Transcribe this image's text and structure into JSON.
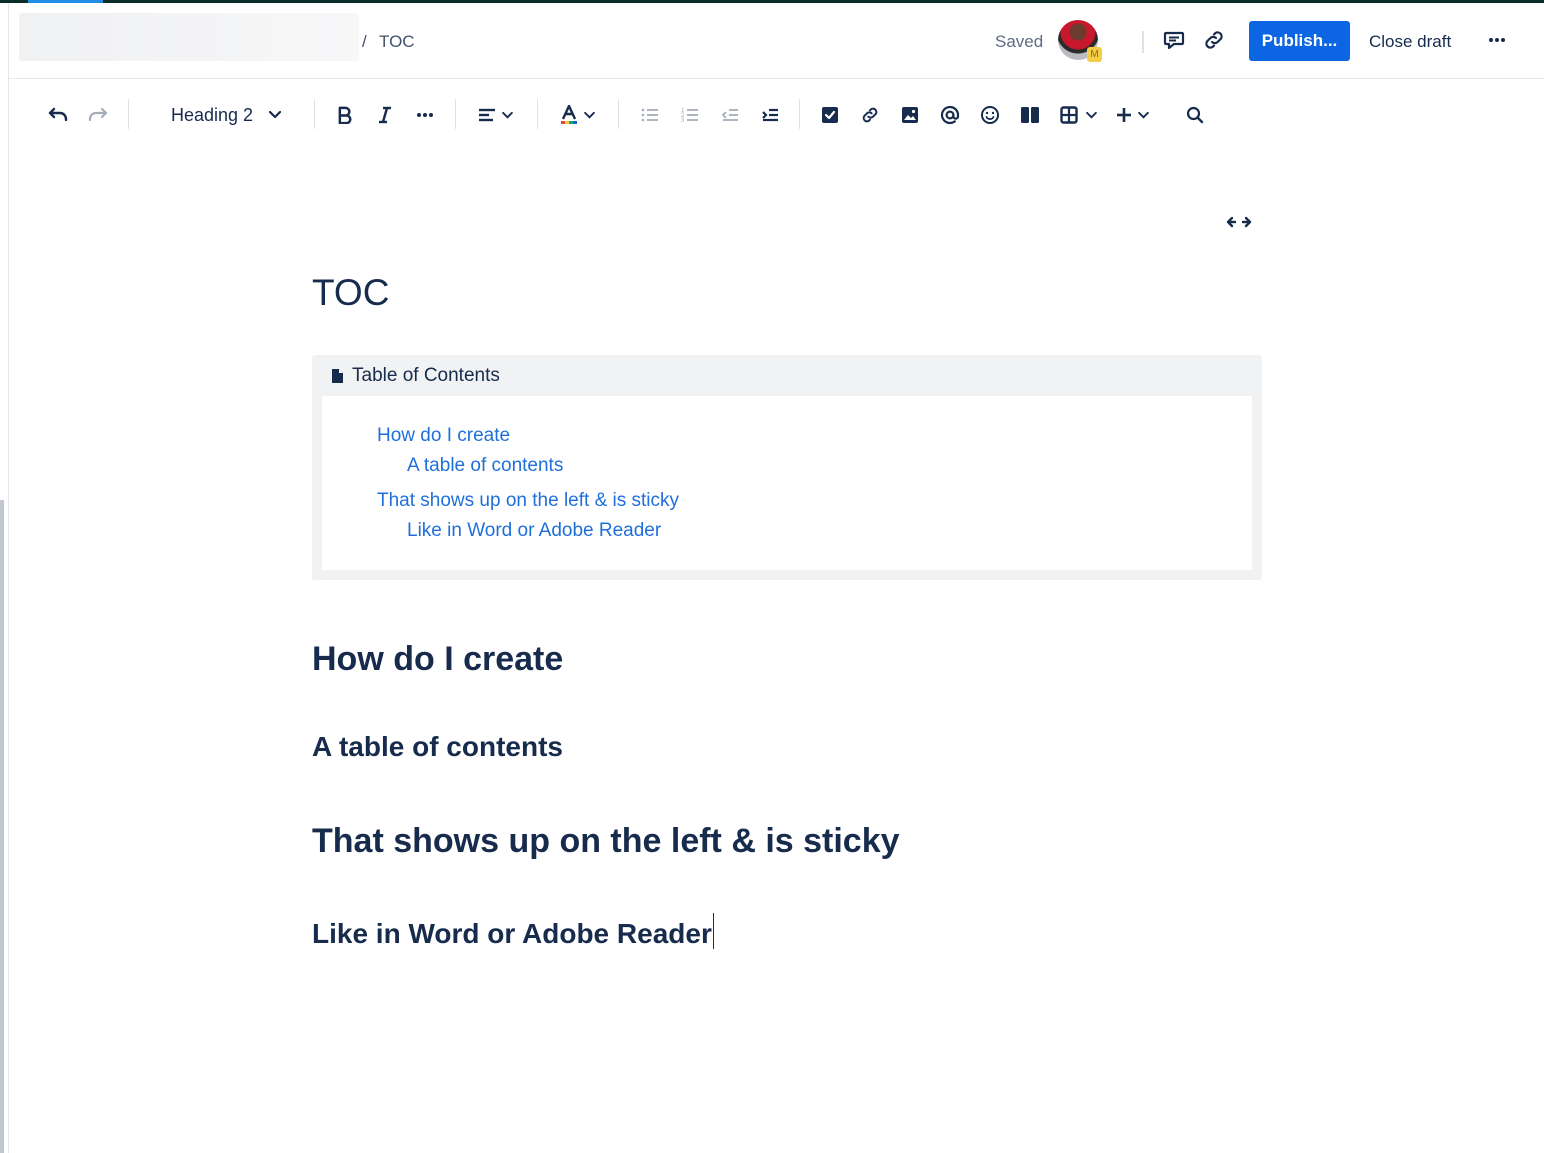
{
  "header": {
    "breadcrumb_separator": "/",
    "breadcrumb_current": "TOC",
    "save_status": "Saved",
    "avatar_badge": "M",
    "publish_label": "Publish...",
    "close_draft_label": "Close draft"
  },
  "toolbar": {
    "text_style": "Heading 2"
  },
  "page": {
    "title": "TOC",
    "toc_macro": {
      "label": "Table of Contents",
      "entries": [
        {
          "text": "How do I create",
          "level": 1
        },
        {
          "text": "A table of contents",
          "level": 2
        },
        {
          "text": "That shows up on the left & is sticky",
          "level": 1
        },
        {
          "text": "Like in Word or Adobe Reader",
          "level": 2
        }
      ]
    },
    "headings": [
      {
        "text": "How do I create",
        "level": "h1"
      },
      {
        "text": "A table of contents",
        "level": "h2"
      },
      {
        "text": "That shows up on the left & is sticky",
        "level": "h1"
      },
      {
        "text": "Like in Word or Adobe Reader",
        "level": "h2"
      }
    ]
  },
  "colors": {
    "primary": "#0c66e4",
    "link": "#1f6fdb",
    "text": "#172b4d",
    "macro_bg": "#f1f2f4"
  }
}
